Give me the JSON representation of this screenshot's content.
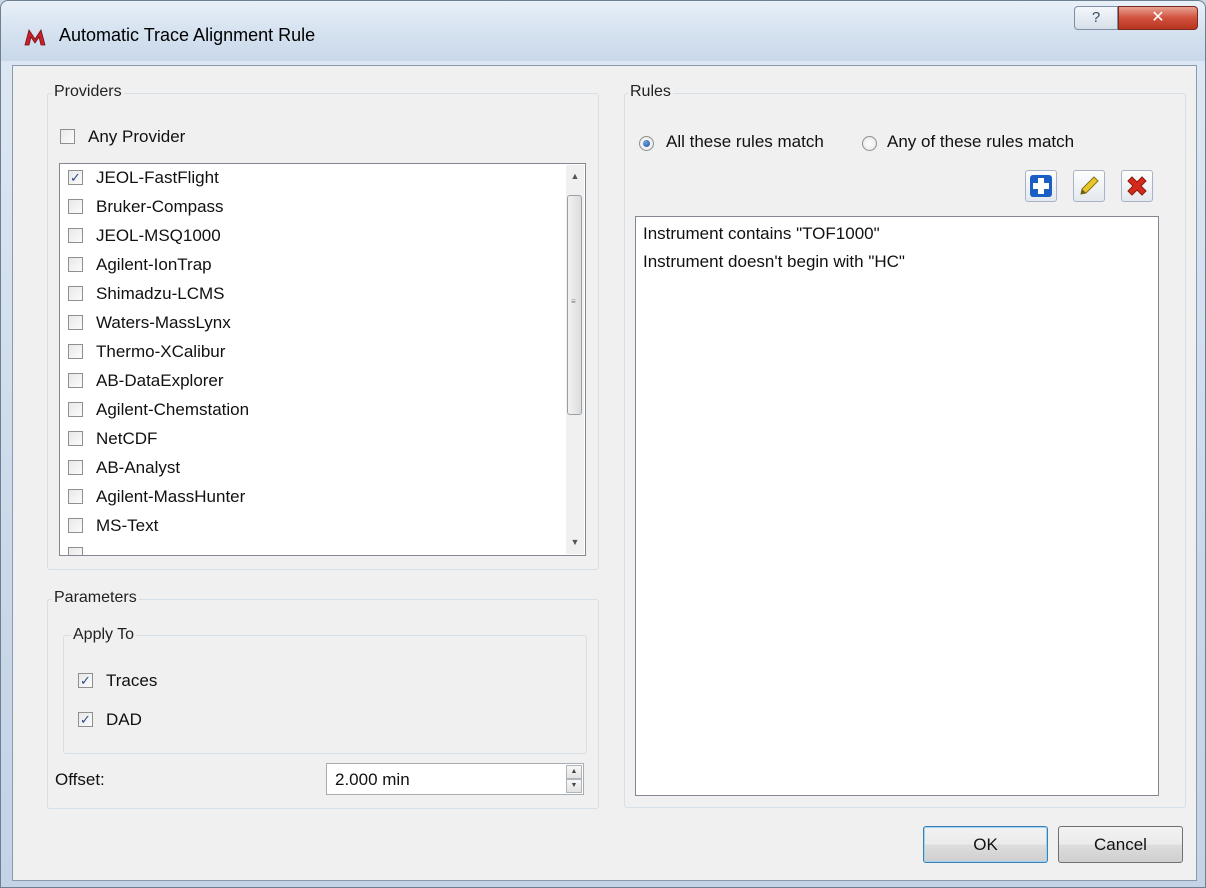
{
  "window": {
    "title": "Automatic Trace Alignment Rule",
    "help_glyph": "?",
    "close_glyph": "✕"
  },
  "providers": {
    "group_label": "Providers",
    "any_provider": {
      "label": "Any Provider",
      "checked": false
    },
    "items": [
      {
        "label": "JEOL-FastFlight",
        "checked": true
      },
      {
        "label": "Bruker-Compass",
        "checked": false
      },
      {
        "label": "JEOL-MSQ1000",
        "checked": false
      },
      {
        "label": "Agilent-IonTrap",
        "checked": false
      },
      {
        "label": "Shimadzu-LCMS",
        "checked": false
      },
      {
        "label": "Waters-MassLynx",
        "checked": false
      },
      {
        "label": "Thermo-XCalibur",
        "checked": false
      },
      {
        "label": "AB-DataExplorer",
        "checked": false
      },
      {
        "label": "Agilent-Chemstation",
        "checked": false
      },
      {
        "label": "NetCDF",
        "checked": false
      },
      {
        "label": "AB-Analyst",
        "checked": false
      },
      {
        "label": "Agilent-MassHunter",
        "checked": false
      },
      {
        "label": "MS-Text",
        "checked": false
      }
    ]
  },
  "parameters": {
    "group_label": "Parameters",
    "apply_to": {
      "group_label": "Apply To",
      "traces": {
        "label": "Traces",
        "checked": true
      },
      "dad": {
        "label": "DAD",
        "checked": true
      }
    },
    "offset": {
      "label": "Offset:",
      "value": "2.000 min"
    }
  },
  "rules": {
    "group_label": "Rules",
    "match_all_label": "All these rules match",
    "match_any_label": "Any of these rules match",
    "selected": "all",
    "items": [
      "Instrument contains \"TOF1000\"",
      "Instrument doesn't begin with \"HC\""
    ]
  },
  "buttons": {
    "ok": "OK",
    "cancel": "Cancel"
  },
  "colors": {
    "add_icon": "#1a5fc4",
    "edit_icon": "#e8c52a",
    "delete_icon": "#d42a1c",
    "title_icon": "#c8202a"
  }
}
